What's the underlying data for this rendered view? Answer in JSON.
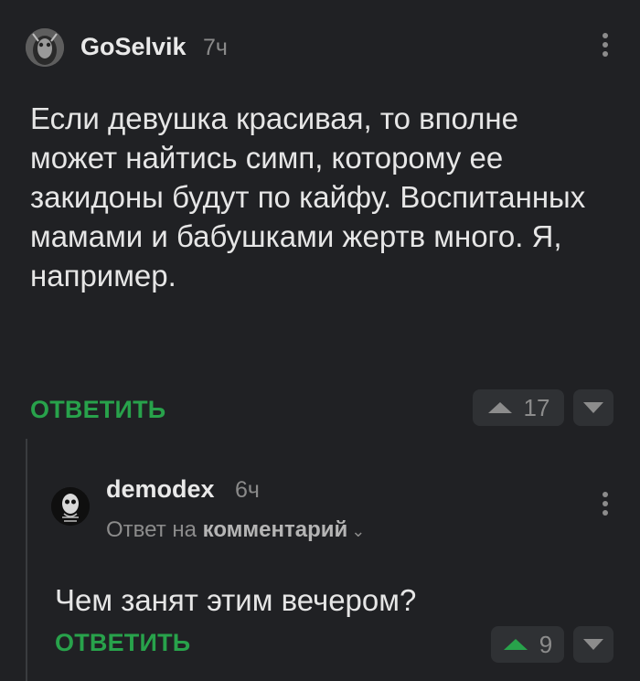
{
  "comments": [
    {
      "username": "GoSelvik",
      "time": "7ч",
      "text": "Если девушка красивая, то вполне может найтись симп, которому ее закидоны будут по кайфу. Воспитанных мамами и бабушками жертв много. Я, например.",
      "reply_label": "ОТВЕТИТЬ",
      "votes": "17",
      "upvote_icon": "triangle-up-icon",
      "downvote_icon": "triangle-down-icon"
    },
    {
      "username": "demodex",
      "time": "6ч",
      "reply_to_prefix": "Ответ на",
      "reply_to_link": "комментарий",
      "text": "Чем занят этим вечером?",
      "reply_label": "ОТВЕТИТЬ",
      "votes": "9",
      "upvote_color": "#28a24b"
    }
  ],
  "colors": {
    "background": "#202124",
    "accent": "#28a24b",
    "button_bg": "#2f3134",
    "muted": "#8a8a8a"
  }
}
